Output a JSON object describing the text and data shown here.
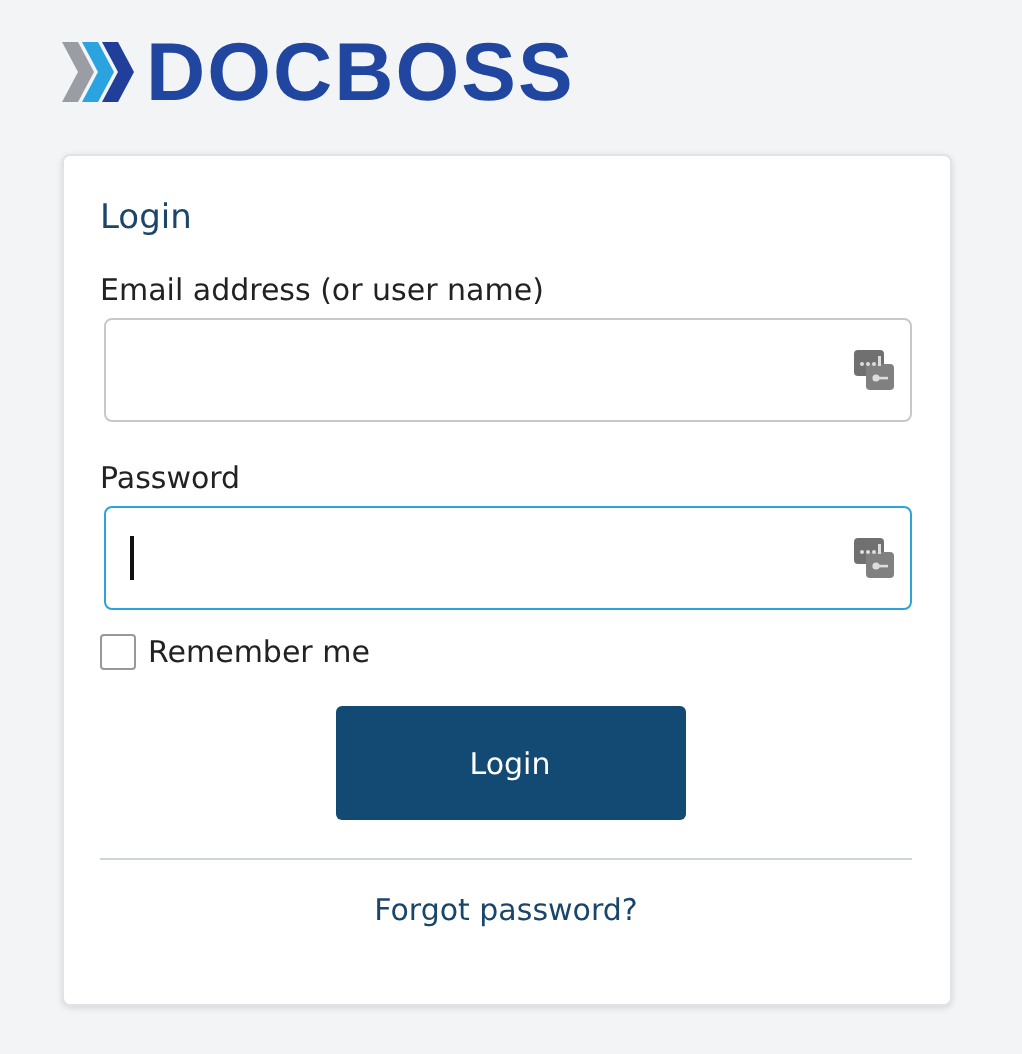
{
  "logo": {
    "text": "DOCBOSS"
  },
  "form": {
    "title": "Login",
    "fields": [
      {
        "label": "Email address (or user name)",
        "focused": false
      },
      {
        "label": "Password",
        "focused": true
      }
    ],
    "remember": {
      "label": "Remember me",
      "checked": false
    },
    "submit": "Login",
    "forgot_link": "Forgot password?"
  }
}
